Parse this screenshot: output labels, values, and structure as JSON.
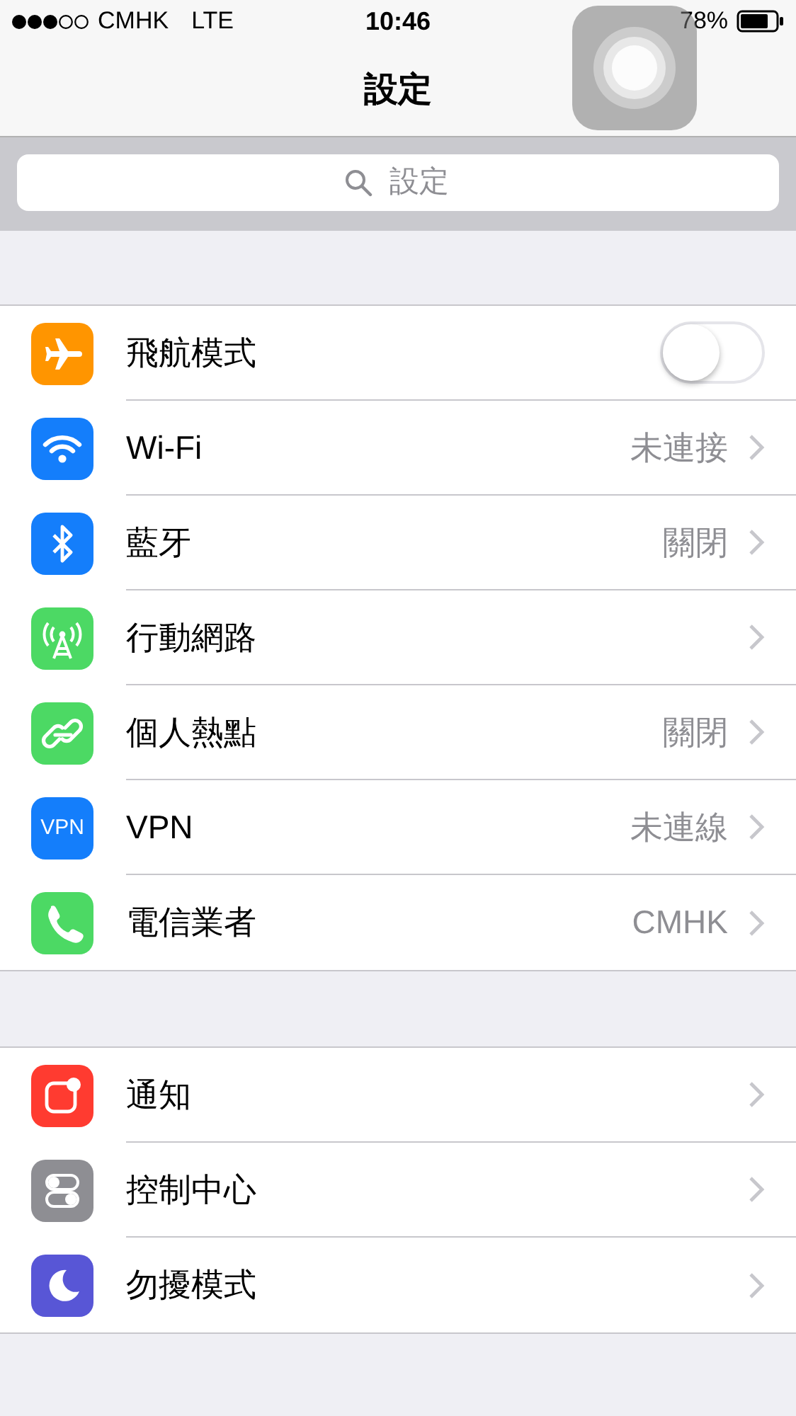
{
  "status_bar": {
    "carrier": "CMHK",
    "network": "LTE",
    "time": "10:46",
    "battery": "78%"
  },
  "nav_bar": {
    "title": "設定"
  },
  "search": {
    "placeholder": "設定"
  },
  "groups": [
    {
      "rows": [
        {
          "kind": "toggle",
          "label": "飛航模式",
          "color": "#ff9500",
          "on": false
        },
        {
          "kind": "detail",
          "label": "Wi-Fi",
          "value": "未連接",
          "color": "#147efb"
        },
        {
          "kind": "detail",
          "label": "藍牙",
          "value": "關閉",
          "color": "#147efb"
        },
        {
          "kind": "detail",
          "label": "行動網路",
          "color": "#4cd964"
        },
        {
          "kind": "detail",
          "label": "個人熱點",
          "value": "關閉",
          "color": "#4cd964"
        },
        {
          "kind": "detail",
          "label": "VPN",
          "value": "未連線",
          "color": "#147efb",
          "icon_text": "VPN"
        },
        {
          "kind": "detail",
          "label": "電信業者",
          "value": "CMHK",
          "color": "#4cd964"
        }
      ]
    },
    {
      "rows": [
        {
          "kind": "detail",
          "label": "通知",
          "color": "#ff3b30"
        },
        {
          "kind": "detail",
          "label": "控制中心",
          "color": "#8e8e93"
        },
        {
          "kind": "detail",
          "label": "勿擾模式",
          "color": "#5856d6"
        }
      ]
    }
  ]
}
